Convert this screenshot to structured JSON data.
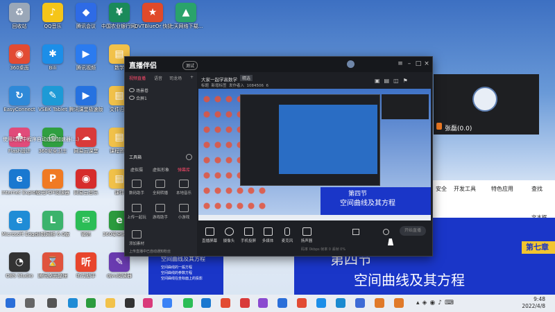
{
  "desktop_icons": [
    {
      "label": "回收站",
      "color": "#9aa7b8",
      "glyph": "♻",
      "col": 0,
      "row": 0
    },
    {
      "label": "QQ音乐",
      "color": "#f5c518",
      "glyph": "♪",
      "col": 1,
      "row": 0
    },
    {
      "label": "腾讯会议",
      "color": "#2e6be6",
      "glyph": "◆",
      "col": 2,
      "row": 0
    },
    {
      "label": "中国农业银行网上银行...",
      "color": "#1a8a5a",
      "glyph": "¥",
      "col": 3,
      "row": 0
    },
    {
      "label": "DVTBlueOr 快捷方式",
      "color": "#e04a2a",
      "glyph": "★",
      "col": 4,
      "row": 0
    },
    {
      "label": "七天网络下载...",
      "color": "#2aa36b",
      "glyph": "▲",
      "col": 5,
      "row": 0
    },
    {
      "label": "360桌面",
      "color": "#e24b33",
      "glyph": "◉",
      "col": 0,
      "row": 1
    },
    {
      "label": "Bili",
      "color": "#1c8ee8",
      "glyph": "✱",
      "col": 1,
      "row": 1
    },
    {
      "label": "腾讯视频",
      "color": "#2b7bef",
      "glyph": "▶",
      "col": 2,
      "row": 1
    },
    {
      "label": "数学",
      "color": "#f2c24a",
      "glyph": "▤",
      "col": 3,
      "row": 1
    },
    {
      "label": "EasyConnect",
      "color": "#2f89d8",
      "glyph": "↻",
      "col": 0,
      "row": 2
    },
    {
      "label": "VSBK Tablet",
      "color": "#1d9ad6",
      "glyph": "✎",
      "col": 1,
      "row": 2
    },
    {
      "label": "腾讯课堂极速版",
      "color": "#2672e0",
      "glyph": "▶",
      "col": 2,
      "row": 2
    },
    {
      "label": "文件归档",
      "color": "#f2c24a",
      "glyph": "▤",
      "col": 3,
      "row": 2
    },
    {
      "label": "Flash设计",
      "color": "#e14b7a",
      "glyph": "♣",
      "col": 0,
      "row": 3
    },
    {
      "label": "360安全卫士",
      "color": "#2f9f40",
      "glyph": "◎",
      "col": 1,
      "row": 3
    },
    {
      "label": "网易云课堂",
      "color": "#d93a3a",
      "glyph": "☁",
      "col": 2,
      "row": 3
    },
    {
      "label": "课程资料",
      "color": "#f2c24a",
      "glyph": "▤",
      "col": 3,
      "row": 3
    },
    {
      "label": "Internet Explorer",
      "color": "#1a78d0",
      "glyph": "e",
      "col": 0,
      "row": 4
    },
    {
      "label": "极光PDF阅读器",
      "color": "#f07a23",
      "glyph": "P",
      "col": 1,
      "row": 4
    },
    {
      "label": "网易云音乐",
      "color": "#d62c2c",
      "glyph": "◉",
      "col": 2,
      "row": 4
    },
    {
      "label": "课件",
      "color": "#f2c24a",
      "glyph": "▤",
      "col": 3,
      "row": 4
    },
    {
      "label": "Microsoft Edge",
      "color": "#1f8cd6",
      "glyph": "e",
      "col": 0,
      "row": 5
    },
    {
      "label": "分数网络 6.0版",
      "color": "#3bb36c",
      "glyph": "L",
      "col": 1,
      "row": 5
    },
    {
      "label": "微信",
      "color": "#2bbd56",
      "glyph": "✉",
      "col": 2,
      "row": 5
    },
    {
      "label": "360安全浏览器",
      "color": "#2c9c3e",
      "glyph": "e",
      "col": 3,
      "row": 5
    },
    {
      "label": "OBS Studio",
      "color": "#333333",
      "glyph": "◔",
      "col": 0,
      "row": 6
    },
    {
      "label": "腾讯桌面整理",
      "color": "#e0533d",
      "glyph": "⌛",
      "col": 1,
      "row": 6
    },
    {
      "label": "听力助手",
      "color": "#e8452c",
      "glyph": "听",
      "col": 2,
      "row": 6
    },
    {
      "label": "djvu阅读器",
      "color": "#6a3bb0",
      "glyph": "✎",
      "col": 3,
      "row": 6
    }
  ],
  "overlay_text": "使用过程中程序自动连接加速器(...)",
  "app": {
    "logo": "直播伴侣",
    "version": "测试",
    "tabs": [
      "视频直播",
      "语音",
      "司龙场"
    ],
    "scenes": [
      "场景卷",
      "合屏1"
    ],
    "stream_title": "大家一起学高数学",
    "title_tag": "精选",
    "meta": [
      "标题",
      "新增标签",
      "发作者入",
      "1084506",
      "6"
    ],
    "tools_label": "工具箱",
    "tool_tabs": [
      "虚拟摄",
      "虚拟形象",
      "弹幕库"
    ],
    "tools": [
      "数码助手",
      "全网转播",
      "本地音乐",
      "上传一起玩",
      "游戏助手",
      "小游戏"
    ],
    "add_scene": "添加素材",
    "notice": "上传直播中已自动通知粉丝",
    "bottom_buttons": [
      "直播屏幕",
      "摄像头",
      "手机投屏",
      "多媒体",
      "麦克风",
      "扬声器"
    ],
    "stats": "码率 0kbps  帧率 0  丢帧 0%",
    "start_button": "开始直播"
  },
  "camera": {
    "name": "张磊(0.0)"
  },
  "ppt": {
    "ribbon": [
      "安全",
      "开发工具",
      "特色应用",
      "查找"
    ],
    "side_label": "文本框"
  },
  "slide": {
    "chapter": "第七章",
    "line1": "第四节",
    "line2": "空间曲线及其方程"
  },
  "thumb_slide": {
    "line1": "第四节",
    "line2": "空间曲线及其方程"
  },
  "left_slide": {
    "title": "空间曲线及其方程",
    "items": [
      "空间曲线的一般方程",
      "空间曲线的参数方程",
      "空间曲线在坐标面上的投影"
    ]
  },
  "taskbar": {
    "time": "9:48",
    "date": "2022/4/8"
  }
}
